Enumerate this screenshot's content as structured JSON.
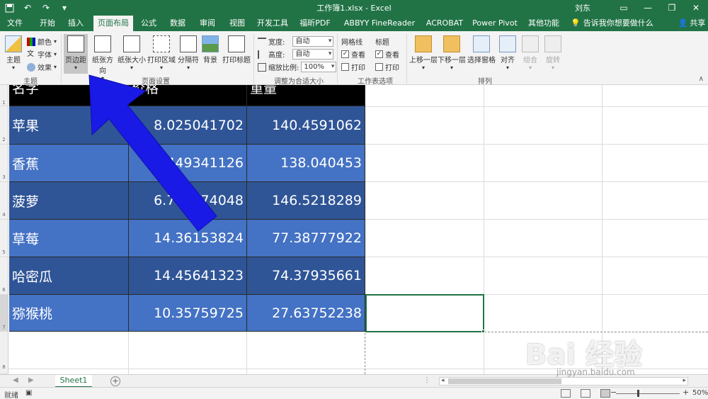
{
  "titlebar": {
    "title": "工作簿1.xlsx  -  Excel",
    "user": "刘东",
    "undo_icon": "undo-icon",
    "redo_icon": "redo-icon"
  },
  "tabs": [
    "文件",
    "开始",
    "插入",
    "页面布局",
    "公式",
    "数据",
    "审阅",
    "视图",
    "开发工具",
    "福昕PDF",
    "ABBYY FineReader 12",
    "ACROBAT",
    "Power Pivot",
    "其他功能"
  ],
  "active_tab": "页面布局",
  "tellme": "告诉我你想要做什么",
  "share": "共享",
  "ribbon": {
    "theme": {
      "big": "主题",
      "colors": "颜色",
      "fonts": "字体",
      "effects": "效果",
      "group": "主题"
    },
    "page_setup": {
      "margins": "页边距",
      "orientation": "纸张方向",
      "size": "纸张大小",
      "print_area": "打印区域",
      "breaks": "分隔符",
      "background": "背景",
      "print_titles": "打印标题",
      "group": "页面设置"
    },
    "scale": {
      "width_label": "宽度:",
      "width_value": "自动",
      "height_label": "高度:",
      "height_value": "自动",
      "scale_label": "缩放比例:",
      "scale_value": "100%",
      "group": "调整为合适大小"
    },
    "sheet_options": {
      "gridlines": "网格线",
      "headings": "标题",
      "view": "查看",
      "print": "打印",
      "group": "工作表选项"
    },
    "arrange": {
      "bring_forward": "上移一层",
      "send_backward": "下移一层",
      "selection_pane": "选择窗格",
      "align": "对齐",
      "group_btn": "组合",
      "rotate": "旋转",
      "group": "排列"
    }
  },
  "table": {
    "headers": [
      "名字",
      "价格",
      "重量"
    ],
    "rows": [
      [
        "苹果",
        "8.025041702",
        "140.4591062"
      ],
      [
        "香蕉",
        "0.449341126",
        "138.040453"
      ],
      [
        "菠萝",
        "6.704974048",
        "146.5218289"
      ],
      [
        "草莓",
        "14.36153824",
        "77.38777922"
      ],
      [
        "哈密瓜",
        "14.45641323",
        "74.37935661"
      ],
      [
        "猕猴桃",
        "10.35759725",
        "27.63752238"
      ]
    ],
    "row_numbers": [
      "1",
      "2",
      "3",
      "4",
      "5",
      "6",
      "7",
      "8"
    ]
  },
  "sheet_tab": "Sheet1",
  "status": {
    "ready": "就绪",
    "zoom": "50%"
  },
  "colors": {
    "excel_green": "#217346",
    "header_black": "#000000",
    "row_dark": "#2f5597",
    "row_light": "#4472c4",
    "arrow_blue": "#1a1ae6"
  },
  "watermark": {
    "logo": "Bai 经验",
    "url": "jingyan.baidu.com"
  }
}
